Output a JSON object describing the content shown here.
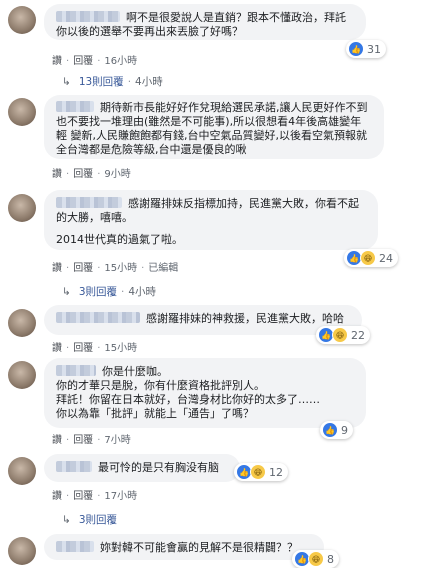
{
  "comments": [
    {
      "text": "啊不是很愛說人是直銷？跟本不懂政治，拜託你以後的選舉不要再出來丟臉了好嗎？",
      "actions": {
        "like": "讚",
        "reply": "回覆",
        "time": "16小時"
      },
      "reactions": "31"
    },
    {
      "text": "期待新市長能好好作兌現給選民承諾,讓人民更好作不到也不要找一堆理由(雖然是不可能事),所以很想看4年後高雄變年輕 變新,人民賺飽飽都有錢,台中空氣品質變好,以後看空氣預報就全台灣都是危險等級,台中還是優良的啾",
      "actions": {
        "like": "讚",
        "reply": "回覆",
        "time": "9小時"
      }
    },
    {
      "text": "感謝羅排妹反指標加持，民進黨大敗，你看不起的大勝，嘻嘻。",
      "text2": "2014世代真的過氣了啦。",
      "actions": {
        "like": "讚",
        "reply": "回覆",
        "time": "15小時",
        "edited": "已編輯"
      },
      "reactions": "24"
    },
    {
      "text": "感謝羅排妹的神救援，民進黨大敗，哈哈",
      "actions": {
        "like": "讚",
        "reply": "回覆",
        "time": "15小時"
      },
      "reactions": "22"
    },
    {
      "text": "你是什麼咖。",
      "lines": [
        "你的才華只是脫，你有什麼資格批評別人。",
        "拜託！你留在日本就好，台灣身材比你好的太多了……",
        "你以為靠「批評」就能上「通告」了嗎？"
      ],
      "actions": {
        "like": "讚",
        "reply": "回覆",
        "time": "7小時"
      },
      "reactions": "9"
    },
    {
      "text": "最可怜的是只有胸没有脑",
      "actions": {
        "like": "讚",
        "reply": "回覆",
        "time": "17小時"
      },
      "reactions": "12"
    },
    {
      "text": "妳對韓不可能會贏的見解不是很精闢？？",
      "reactions": "8"
    }
  ],
  "reply_threads": [
    {
      "label": "13則回覆",
      "time": "4小時"
    },
    {
      "label": "3則回覆",
      "time": "4小時"
    },
    {
      "label": "3則回覆",
      "time": ""
    }
  ],
  "colors": {
    "bubble": "#f2f3f5",
    "link": "#385898",
    "like": "#3578e5",
    "haha": "#f7c948"
  },
  "icons": {
    "reply_arrow": "reply-arrow-icon",
    "like": "like-reaction-icon",
    "haha": "haha-reaction-icon"
  }
}
